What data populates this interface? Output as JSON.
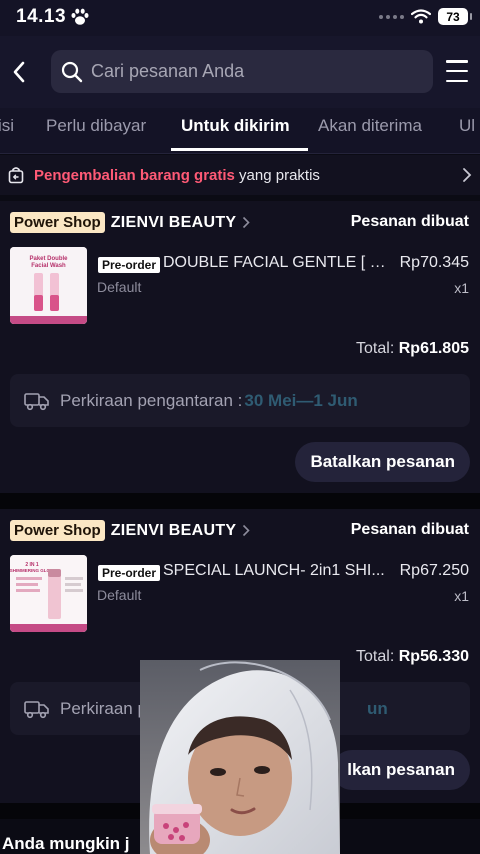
{
  "status_bar": {
    "time": "14.13",
    "battery": "73"
  },
  "header": {
    "search_placeholder": "Cari pesanan Anda"
  },
  "tabs": [
    {
      "label": "isi",
      "active": false
    },
    {
      "label": "Perlu dibayar",
      "active": false
    },
    {
      "label": "Untuk dikirim",
      "active": true
    },
    {
      "label": "Akan diterima",
      "active": false
    },
    {
      "label": "Ul",
      "active": false
    }
  ],
  "return_banner": {
    "highlight": "Pengembalian barang gratis",
    "text": " yang praktis"
  },
  "orders": [
    {
      "badge": "Power Shop",
      "shop_name": "ZIENVI BEAUTY",
      "status": "Pesanan dibuat",
      "preorder_label": "Pre-order",
      "product_title": "DOUBLE FACIAL GENTLE [ (...",
      "variant": "Default",
      "price": "Rp70.345",
      "quantity": "x1",
      "thumb_text": "Paket Double Facial Wash",
      "total_label": "Total:",
      "total_value": "Rp61.805",
      "delivery_label": "Perkiraan pengantaran : ",
      "delivery_date": "30 Mei—1 Jun",
      "cancel_label": "Batalkan pesanan"
    },
    {
      "badge": "Power Shop",
      "shop_name": "ZIENVI BEAUTY",
      "status": "Pesanan dibuat",
      "preorder_label": "Pre-order",
      "product_title": "SPECIAL LAUNCH- 2in1 SHI...",
      "variant": "Default",
      "price": "Rp67.250",
      "quantity": "x1",
      "thumb_text": "2 IN 1 SHIMMERING GLOW",
      "total_label": "Total:",
      "total_value": "Rp56.330",
      "delivery_label": "Perkiraan p",
      "delivery_date": "un",
      "cancel_label": "lkan pesanan"
    }
  ],
  "recommendations_title": "Anda mungkin j",
  "colors": {
    "background": "#0b0b14",
    "card": "#12111f",
    "accent_red": "#ff5a76",
    "badge": "#fbe7c4",
    "delivery_date": "#2f5b72"
  }
}
